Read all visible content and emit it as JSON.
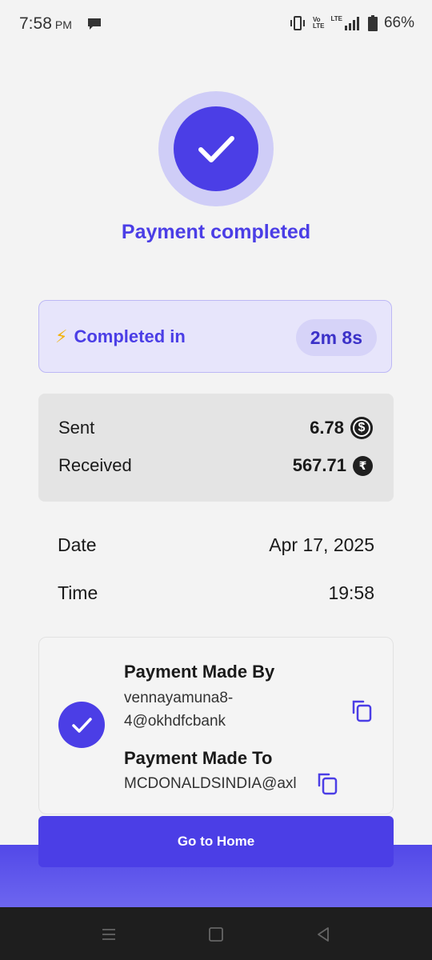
{
  "status_bar": {
    "time": "7:58",
    "ampm": "PM",
    "net_top": "Vo",
    "net_bottom": "LTE",
    "lte": "LTE",
    "battery_percent": "66%"
  },
  "header": {
    "title": "Payment completed"
  },
  "completed": {
    "label": "Completed in",
    "duration": "2m 8s"
  },
  "amounts": {
    "sent_label": "Sent",
    "sent_value": "6.78",
    "sent_currency_symbol": "$",
    "received_label": "Received",
    "received_value": "567.71",
    "received_currency_symbol": "₹"
  },
  "details": {
    "date_label": "Date",
    "date_value": "Apr 17, 2025",
    "time_label": "Time",
    "time_value": "19:58"
  },
  "parties": {
    "made_by_heading": "Payment Made By",
    "made_by_line1": "vennayamuna8-",
    "made_by_line2": "4@okhdfcbank",
    "made_to_heading": "Payment Made To",
    "made_to_value": "MCDONALDSINDIA@axl"
  },
  "actions": {
    "home_label": "Go to Home"
  },
  "colors": {
    "accent": "#4b3ee6",
    "accent_light": "#cfcdf7",
    "bolt": "#f2b20b"
  }
}
